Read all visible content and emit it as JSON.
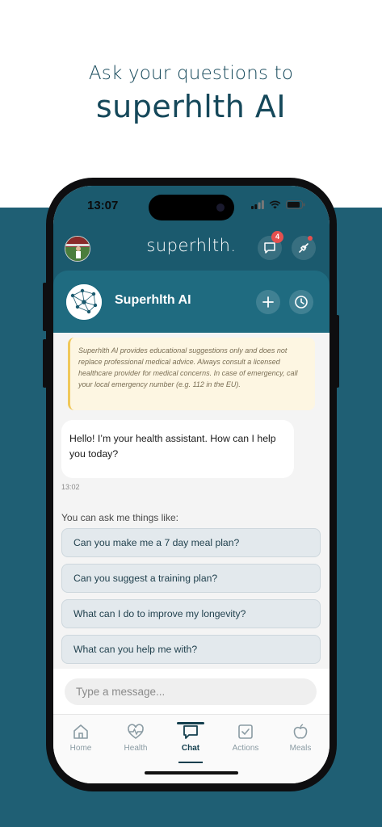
{
  "headline": {
    "line1": "Ask your questions to",
    "line2": "superhlth AI"
  },
  "status_bar": {
    "time": "13:07"
  },
  "app_bar": {
    "logo": "superhlth.",
    "messages_badge": "4"
  },
  "chat_header": {
    "name": "Superhlth AI"
  },
  "disclaimer": "Superhlth AI provides educational suggestions only and does not replace professional medical advice. Always consult a licensed healthcare provider for medical concerns. In case of emergency, call your local emergency number (e.g. 112 in the EU).",
  "messages": [
    {
      "text": "Hello! I’m your health assistant. How can I help you today?",
      "time": "13:02"
    }
  ],
  "suggestions": {
    "title": "You can ask me things like:",
    "items": [
      "Can you make me a 7 day meal plan?",
      "Can you suggest a training plan?",
      "What can I do to improve my longevity?",
      "What can you help me with?"
    ]
  },
  "input": {
    "placeholder": "Type a message..."
  },
  "tabs": [
    {
      "label": "Home",
      "icon": "home-icon"
    },
    {
      "label": "Health",
      "icon": "heart-pulse-icon"
    },
    {
      "label": "Chat",
      "icon": "chat-icon",
      "active": true
    },
    {
      "label": "Actions",
      "icon": "checkbox-icon"
    },
    {
      "label": "Meals",
      "icon": "apple-icon"
    }
  ],
  "colors": {
    "brand_dark": "#1b5a6e",
    "header": "#1f6b80",
    "background_band": "#1f5f74",
    "badge": "#e4504f",
    "accent_text": "#143f4e"
  }
}
